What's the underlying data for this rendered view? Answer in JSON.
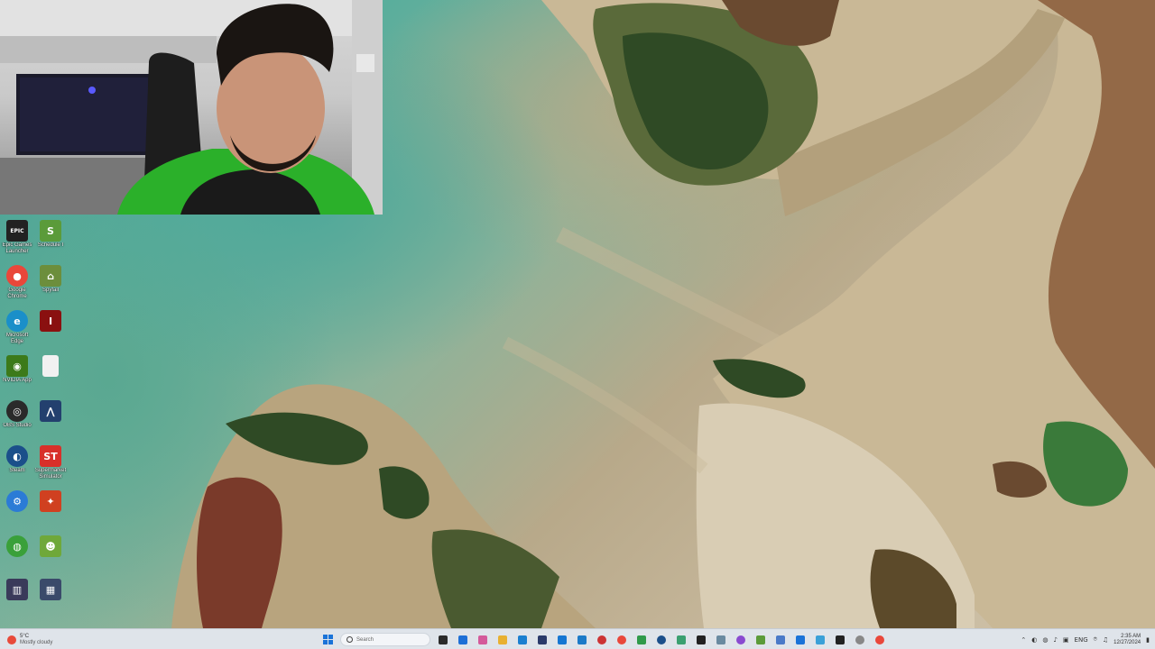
{
  "desktop": {
    "icons": [
      {
        "id": "epic",
        "label": "Epic Games Launcher",
        "glyph": "EPIC",
        "color": "#222222"
      },
      {
        "id": "schedule",
        "label": "Schedule I",
        "glyph": "S",
        "color": "#5b9b3a"
      },
      {
        "id": "chrome",
        "label": "Google Chrome",
        "glyph": "●",
        "color": "#e9473a"
      },
      {
        "id": "spyfall",
        "label": "Spyfall",
        "glyph": "⌂",
        "color": "#6c8e3c"
      },
      {
        "id": "edge",
        "label": "Microsoft Edge",
        "glyph": "e",
        "color": "#1a8fc9"
      },
      {
        "id": "game1",
        "label": "",
        "glyph": "I",
        "color": "#8a1010"
      },
      {
        "id": "nvidia",
        "label": "NVIDIA App",
        "glyph": "◉",
        "color": "#3c7a1a"
      },
      {
        "id": "file",
        "label": "",
        "glyph": "",
        "color": "#f1f1f1"
      },
      {
        "id": "obs",
        "label": "OBS Studio",
        "glyph": "◎",
        "color": "#2a2a2a"
      },
      {
        "id": "app2",
        "label": "",
        "glyph": "⋀",
        "color": "#23406e"
      },
      {
        "id": "steam",
        "label": "Steam",
        "glyph": "◐",
        "color": "#1b4f8a"
      },
      {
        "id": "supermarket",
        "label": "Supermarket Simulator",
        "glyph": "ST",
        "color": "#d8302a"
      },
      {
        "id": "app3",
        "label": "",
        "glyph": "⚙",
        "color": "#2b7bd6"
      },
      {
        "id": "app4",
        "label": "",
        "glyph": "✦",
        "color": "#d04020"
      },
      {
        "id": "app5",
        "label": "",
        "glyph": "◍",
        "color": "#3aa03a"
      },
      {
        "id": "app6",
        "label": "",
        "glyph": "☻",
        "color": "#6fa83a"
      },
      {
        "id": "app7",
        "label": "",
        "glyph": "▥",
        "color": "#3a3a5a"
      },
      {
        "id": "app8",
        "label": "",
        "glyph": "▦",
        "color": "#3a4a6a"
      }
    ]
  },
  "taskbar": {
    "weather": {
      "temp": "5°C",
      "condition": "Mostly cloudy"
    },
    "search_placeholder": "Search",
    "apps": [
      {
        "id": "task-view",
        "color": "#2a2a2a"
      },
      {
        "id": "explorer",
        "color": "#1d6fd6"
      },
      {
        "id": "app-a",
        "color": "#d45a9a"
      },
      {
        "id": "app-b",
        "color": "#e8b030"
      },
      {
        "id": "app-c",
        "color": "#1a7fd0"
      },
      {
        "id": "app-d",
        "color": "#2a3a6a"
      },
      {
        "id": "app-e",
        "color": "#1576d2"
      },
      {
        "id": "app-f",
        "color": "#1b7ac8"
      },
      {
        "id": "app-g",
        "color": "#cc3333"
      },
      {
        "id": "app-h",
        "color": "#e9473a"
      },
      {
        "id": "app-i",
        "color": "#2f9a4a"
      },
      {
        "id": "app-j",
        "color": "#1b4f8a"
      },
      {
        "id": "app-k",
        "color": "#3aa070"
      },
      {
        "id": "app-l",
        "color": "#222222"
      },
      {
        "id": "app-m",
        "color": "#6a8aa0"
      },
      {
        "id": "app-n",
        "color": "#8a4ad0"
      },
      {
        "id": "app-o",
        "color": "#5b9b3a"
      },
      {
        "id": "app-p",
        "color": "#4a7ac8"
      },
      {
        "id": "app-q",
        "color": "#1a73d8"
      },
      {
        "id": "app-r",
        "color": "#3aa0d8"
      },
      {
        "id": "app-s",
        "color": "#222222"
      },
      {
        "id": "app-t",
        "color": "#888888"
      },
      {
        "id": "app-u",
        "color": "#e9473a"
      }
    ],
    "tray": {
      "language": "ENG",
      "time": "2:35 AM",
      "date": "12/27/2024"
    }
  }
}
